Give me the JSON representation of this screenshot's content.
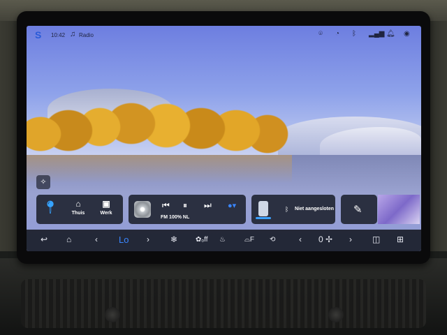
{
  "status_bar": {
    "time": "10:42",
    "radio_label": "Radio",
    "icons": [
      "location-icon",
      "speed-icon",
      "bluetooth-icon",
      "signal-icon",
      "bell-icon",
      "user-icon"
    ]
  },
  "nav_widget": {
    "home_label": "Thuis",
    "work_label": "Werk"
  },
  "media_widget": {
    "station": "FM 100% NL"
  },
  "phone_widget": {
    "status": "Niet aangesloten"
  },
  "climate_bar": {
    "temperature": "Lo",
    "fan_speed": "0"
  },
  "colors": {
    "accent": "#3a86ff",
    "bar_bg": "#1e222e"
  }
}
